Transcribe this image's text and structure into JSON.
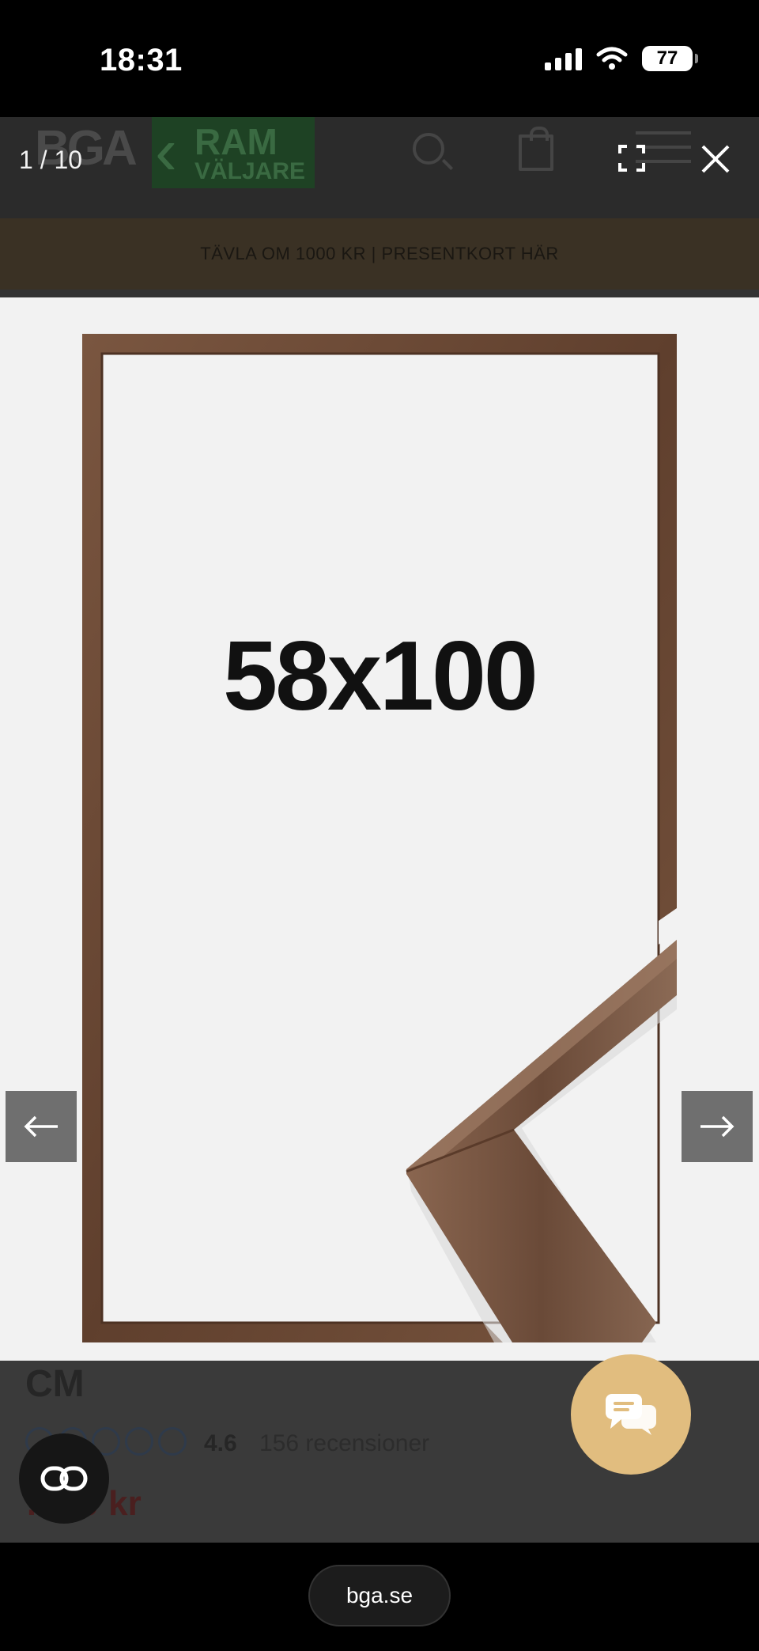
{
  "status_bar": {
    "time": "18:31",
    "battery": "77",
    "icons": [
      "signal-icon",
      "wifi-icon",
      "battery-icon"
    ]
  },
  "site_header": {
    "logo": "BGA",
    "ramvaljare_top": "RAM",
    "ramvaljare_bottom": "VÄLJARE",
    "icons": [
      "search-icon",
      "bag-icon",
      "menu-icon"
    ]
  },
  "promo": {
    "text": "TÄVLA OM 1000 KR | PRESENTKORT HÄR"
  },
  "lightbox": {
    "counter": "1 / 10",
    "image_text": "58x100",
    "icons": [
      "fullscreen-icon",
      "close-icon",
      "arrow-left-icon",
      "arrow-right-icon"
    ]
  },
  "product": {
    "title_tail": "CM",
    "rating": "4.6",
    "reviews": "156 recensioner",
    "price": "…90 kr",
    "star_count": 5
  },
  "floating": {
    "icons": [
      "chat-icon",
      "link-icon"
    ]
  },
  "browser": {
    "url": "bga.se"
  },
  "colors": {
    "background": "#000000",
    "image_bg": "#f2f2f2",
    "frame_wood": "#6e4a36",
    "chat_button": "#e1bd7f",
    "nav_button": "#6f6f6f"
  }
}
